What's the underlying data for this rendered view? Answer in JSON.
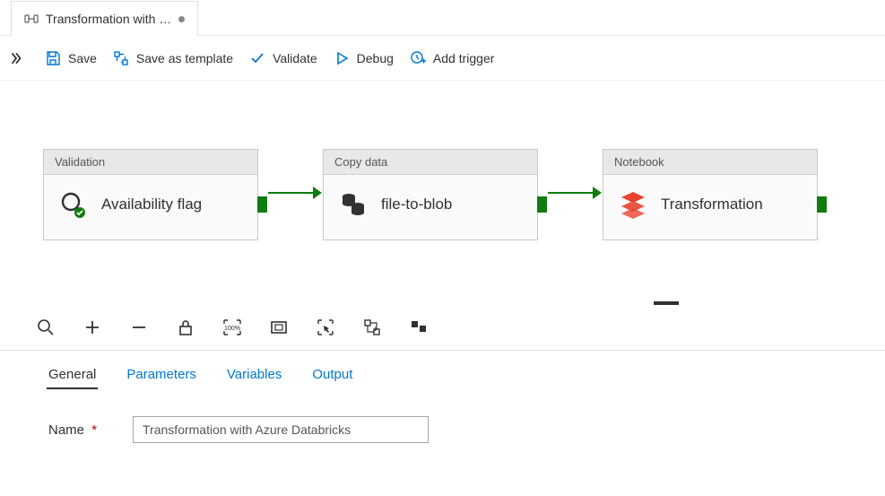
{
  "tab": {
    "title": "Transformation with …"
  },
  "toolbar": {
    "save": "Save",
    "save_template": "Save as template",
    "validate": "Validate",
    "debug": "Debug",
    "add_trigger": "Add trigger"
  },
  "activities": {
    "a1": {
      "type": "Validation",
      "title": "Availability flag"
    },
    "a2": {
      "type": "Copy data",
      "title": "file-to-blob"
    },
    "a3": {
      "type": "Notebook",
      "title": "Transformation"
    }
  },
  "detail_tabs": {
    "general": "General",
    "parameters": "Parameters",
    "variables": "Variables",
    "output": "Output"
  },
  "form": {
    "name_label": "Name",
    "name_value": "Transformation with Azure Databricks"
  }
}
